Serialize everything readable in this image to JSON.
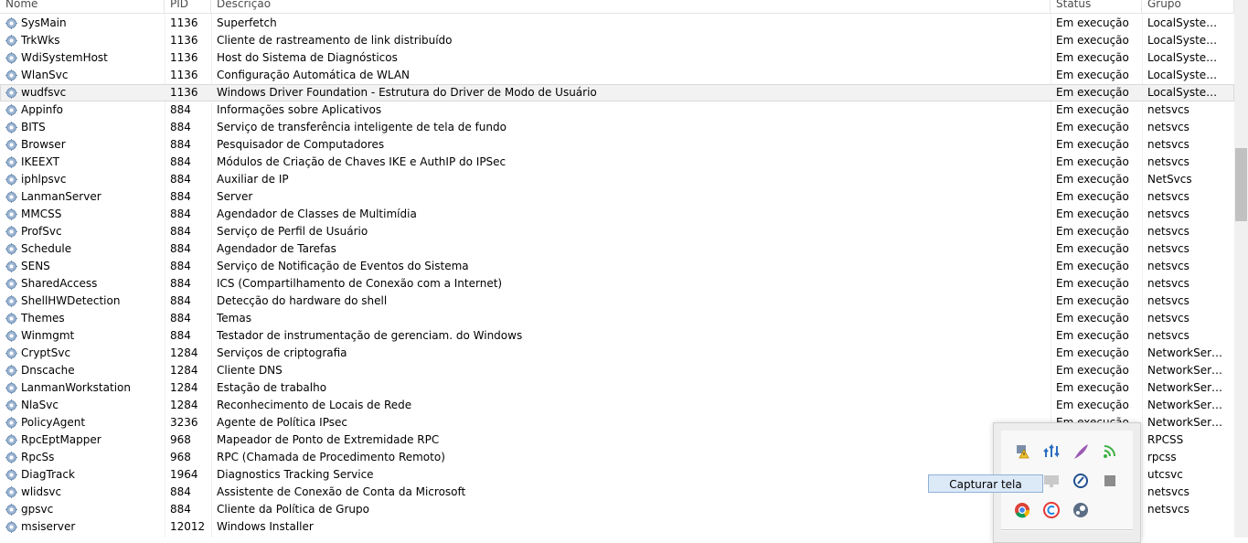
{
  "columns": {
    "name": "Nome",
    "pid": "PID",
    "description": "Descrição",
    "status": "Status",
    "group": "Grupo"
  },
  "rows": [
    {
      "name": "SysMain",
      "pid": "1136",
      "description": "Superfetch",
      "status": "Em execução",
      "group": "LocalSystemN..."
    },
    {
      "name": "TrkWks",
      "pid": "1136",
      "description": "Cliente de rastreamento de link distribuído",
      "status": "Em execução",
      "group": "LocalSystemN..."
    },
    {
      "name": "WdiSystemHost",
      "pid": "1136",
      "description": "Host do Sistema de Diagnósticos",
      "status": "Em execução",
      "group": "LocalSystemN..."
    },
    {
      "name": "WlanSvc",
      "pid": "1136",
      "description": "Configuração Automática de WLAN",
      "status": "Em execução",
      "group": "LocalSystemN..."
    },
    {
      "name": "wudfsvc",
      "pid": "1136",
      "description": "Windows Driver Foundation - Estrutura do Driver de Modo de Usuário",
      "status": "Em execução",
      "group": "LocalSystemN..."
    },
    {
      "name": "Appinfo",
      "pid": "884",
      "description": "Informações sobre Aplicativos",
      "status": "Em execução",
      "group": "netsvcs"
    },
    {
      "name": "BITS",
      "pid": "884",
      "description": "Serviço de transferência inteligente de tela de fundo",
      "status": "Em execução",
      "group": "netsvcs"
    },
    {
      "name": "Browser",
      "pid": "884",
      "description": "Pesquisador de Computadores",
      "status": "Em execução",
      "group": "netsvcs"
    },
    {
      "name": "IKEEXT",
      "pid": "884",
      "description": "Módulos de Criação de Chaves IKE e AuthIP do IPSec",
      "status": "Em execução",
      "group": "netsvcs"
    },
    {
      "name": "iphlpsvc",
      "pid": "884",
      "description": "Auxiliar de IP",
      "status": "Em execução",
      "group": "NetSvcs"
    },
    {
      "name": "LanmanServer",
      "pid": "884",
      "description": "Server",
      "status": "Em execução",
      "group": "netsvcs"
    },
    {
      "name": "MMCSS",
      "pid": "884",
      "description": "Agendador de Classes de Multimídia",
      "status": "Em execução",
      "group": "netsvcs"
    },
    {
      "name": "ProfSvc",
      "pid": "884",
      "description": "Serviço de Perfil de Usuário",
      "status": "Em execução",
      "group": "netsvcs"
    },
    {
      "name": "Schedule",
      "pid": "884",
      "description": "Agendador de Tarefas",
      "status": "Em execução",
      "group": "netsvcs"
    },
    {
      "name": "SENS",
      "pid": "884",
      "description": "Serviço de Notificação de Eventos do Sistema",
      "status": "Em execução",
      "group": "netsvcs"
    },
    {
      "name": "SharedAccess",
      "pid": "884",
      "description": "ICS (Compartilhamento de Conexão com a Internet)",
      "status": "Em execução",
      "group": "netsvcs"
    },
    {
      "name": "ShellHWDetection",
      "pid": "884",
      "description": "Detecção do hardware do shell",
      "status": "Em execução",
      "group": "netsvcs"
    },
    {
      "name": "Themes",
      "pid": "884",
      "description": "Temas",
      "status": "Em execução",
      "group": "netsvcs"
    },
    {
      "name": "Winmgmt",
      "pid": "884",
      "description": "Testador de instrumentação de gerenciam. do Windows",
      "status": "Em execução",
      "group": "netsvcs"
    },
    {
      "name": "CryptSvc",
      "pid": "1284",
      "description": "Serviços de criptografia",
      "status": "Em execução",
      "group": "NetworkService"
    },
    {
      "name": "Dnscache",
      "pid": "1284",
      "description": "Cliente DNS",
      "status": "Em execução",
      "group": "NetworkService"
    },
    {
      "name": "LanmanWorkstation",
      "pid": "1284",
      "description": "Estação de trabalho",
      "status": "Em execução",
      "group": "NetworkService"
    },
    {
      "name": "NlaSvc",
      "pid": "1284",
      "description": "Reconhecimento de Locais de Rede",
      "status": "Em execução",
      "group": "NetworkService"
    },
    {
      "name": "PolicyAgent",
      "pid": "3236",
      "description": "Agente de Política IPsec",
      "status": "Em execução",
      "group": "NetworkServic..."
    },
    {
      "name": "RpcEptMapper",
      "pid": "968",
      "description": "Mapeador de Ponto de Extremidade RPC",
      "status": "",
      "group": "RPCSS"
    },
    {
      "name": "RpcSs",
      "pid": "968",
      "description": "RPC (Chamada de Procedimento Remoto)",
      "status": "",
      "group": "rpcss"
    },
    {
      "name": "DiagTrack",
      "pid": "1964",
      "description": "Diagnostics Tracking Service",
      "status": "",
      "group": "utcsvc"
    },
    {
      "name": "wlidsvc",
      "pid": "884",
      "description": "Assistente de Conexão de Conta da Microsoft",
      "status": "",
      "group": "netsvcs"
    },
    {
      "name": "gpsvc",
      "pid": "884",
      "description": "Cliente da Política de Grupo",
      "status": "",
      "group": "netsvcs"
    },
    {
      "name": "msiserver",
      "pid": "12012",
      "description": "Windows Installer",
      "status": "",
      "group": ""
    }
  ],
  "tray": {
    "icons": [
      "warning-flag-icon",
      "network-activity-icon",
      "feather-icon",
      "wifi-signal-icon",
      "unknown-app-icon",
      "monitor-icon",
      "pen-circle-icon",
      "square-app-icon",
      "chrome-icon",
      "ccleaner-icon",
      "steam-icon"
    ],
    "tooltip": "Capturar tela"
  },
  "colors": {
    "selected_row": "#f2f2f2",
    "tooltip_bg": "#dce9f7",
    "gear": "#6e8fb5"
  }
}
